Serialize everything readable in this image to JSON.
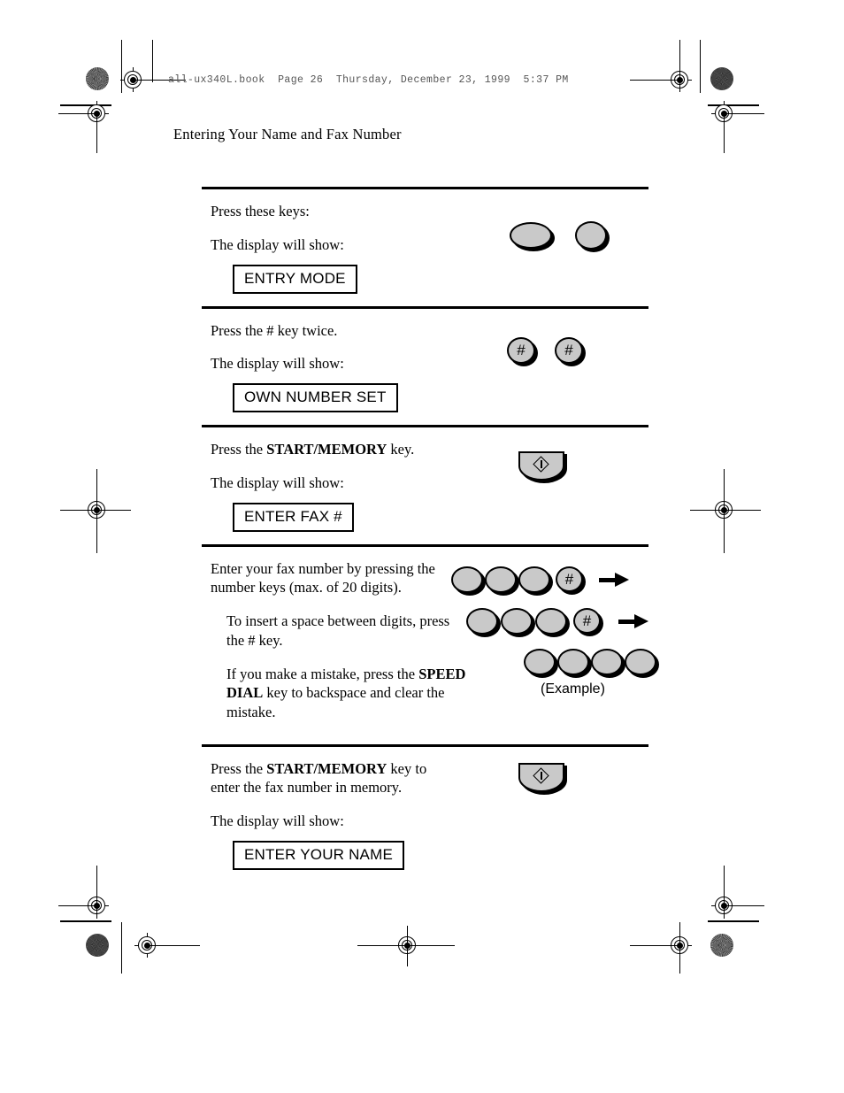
{
  "page": {
    "filestamp": "all-ux340L.book  Page 26  Thursday, December 23, 1999  5:37 PM",
    "running_head": "Entering Your Name and Fax Number",
    "page_number": "26"
  },
  "colors": {
    "key_face": "#c9c9c9",
    "ink": "#000000",
    "paper": "#ffffff",
    "stamp_text": "#555555"
  },
  "steps": [
    {
      "id": "step-entry-mode",
      "lines": [
        {
          "text": "Press these keys:",
          "indent": false,
          "bold_spans": []
        },
        {
          "text": "The display will show:",
          "indent": false,
          "bold_spans": []
        }
      ],
      "display": "ENTRY MODE",
      "keys": [
        {
          "type": "ellipse-wide",
          "label": ""
        },
        {
          "type": "ellipse-round",
          "label": ""
        }
      ]
    },
    {
      "id": "step-own-number-set",
      "lines": [
        {
          "text": "Press the # key twice.",
          "indent": false,
          "bold_spans": []
        },
        {
          "text": "The display will show:",
          "indent": false,
          "bold_spans": []
        }
      ],
      "display": "OWN NUMBER SET",
      "keys": [
        {
          "type": "hash",
          "label": "#"
        },
        {
          "type": "hash",
          "label": "#"
        }
      ]
    },
    {
      "id": "step-enter-fax-number",
      "lines": [
        {
          "text": "Press the START/MEMORY key.",
          "indent": false,
          "bold": "START/MEMORY"
        },
        {
          "text": "The display will show:",
          "indent": false,
          "bold_spans": []
        }
      ],
      "display": "ENTER FAX #",
      "keys": [
        {
          "type": "start-memory",
          "label": ""
        }
      ]
    },
    {
      "id": "step-type-fax-digits",
      "lines": [
        {
          "text": "Enter your fax number by pressing the number keys (max. of 20 digits).",
          "indent": false,
          "bold_spans": []
        },
        {
          "text": "To insert  a space between digits, press the # key.",
          "indent": true,
          "bold_spans": []
        },
        {
          "text": "If you make a mistake, press the SPEED DIAL key to backspace and clear the mistake.",
          "indent": true,
          "bold": "SPEED DIAL"
        }
      ],
      "display": null,
      "key_rows": [
        {
          "keys": [
            "digit",
            "digit",
            "digit",
            "hash"
          ],
          "arrow": true
        },
        {
          "keys": [
            "digit",
            "digit",
            "digit",
            "hash"
          ],
          "arrow": true
        },
        {
          "keys": [
            "digit",
            "digit",
            "digit",
            "digit"
          ],
          "arrow": false
        }
      ],
      "caption": "(Example)"
    },
    {
      "id": "step-enter-your-name",
      "lines": [
        {
          "text": "Press the START/MEMORY key to enter the fax number in memory.",
          "indent": false,
          "bold": "START/MEMORY"
        },
        {
          "text": "The display will show:",
          "indent": false,
          "bold_spans": []
        }
      ],
      "display": "ENTER YOUR NAME",
      "keys": [
        {
          "type": "start-memory",
          "label": ""
        }
      ]
    }
  ],
  "text": {
    "s1_line1": "Press these keys:",
    "s1_line2": "The display will show:",
    "s1_display": "ENTRY MODE",
    "s2_line1": "Press the # key twice.",
    "s2_line2": "The display will show:",
    "s2_display": "OWN NUMBER SET",
    "s3_line1_pre": "Press the ",
    "s3_line1_bold": "START/MEMORY",
    "s3_line1_post": " key.",
    "s3_line2": "The display will show:",
    "s3_display": "ENTER FAX #",
    "s4_p1": "Enter your fax number by pressing the number keys (max. of 20 digits).",
    "s4_p2": "To insert  a space between digits, press the # key.",
    "s4_p3_pre": "If you make a mistake, press the ",
    "s4_p3_bold": "SPEED DIAL",
    "s4_p3_post": " key to backspace and clear the mistake.",
    "s4_caption": "(Example)",
    "s5_line1_pre": "Press the ",
    "s5_line1_bold": "START/MEMORY",
    "s5_line1_post": " key to enter the fax number in memory.",
    "s5_line2": "The display will show:",
    "s5_display": "ENTER YOUR NAME",
    "hash_glyph": "#"
  }
}
